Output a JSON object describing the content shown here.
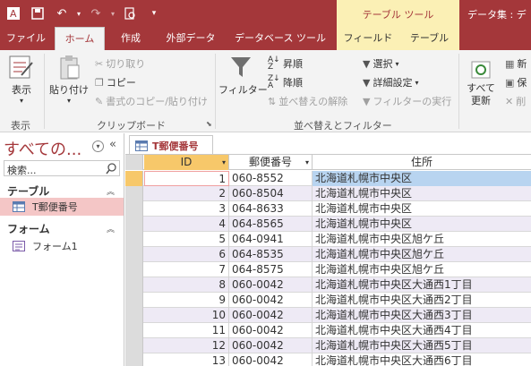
{
  "colors": {
    "accent": "#a4373a",
    "context": "#fbf0b5",
    "selected_row": "#f7c86a",
    "alt_row": "#eeeaf5",
    "nav_selected": "#f4c6c6"
  },
  "window": {
    "title": "データ集 : デ",
    "context_group": "テーブル ツール"
  },
  "qat": {
    "icons": [
      "save-icon",
      "undo-icon",
      "redo-icon",
      "print-preview-icon",
      "customize-icon"
    ]
  },
  "tabs": [
    {
      "label": "ファイル"
    },
    {
      "label": "ホーム"
    },
    {
      "label": "作成"
    },
    {
      "label": "外部データ"
    },
    {
      "label": "データベース ツール"
    },
    {
      "label": "フィールド"
    },
    {
      "label": "テーブル"
    }
  ],
  "ribbon": {
    "view": {
      "label": "表示",
      "group": "表示"
    },
    "clipboard": {
      "paste": "貼り付け",
      "cut": "切り取り",
      "copy": "コピー",
      "format_painter": "書式のコピー/貼り付け",
      "group": "クリップボード"
    },
    "sort": {
      "filter": "フィルター",
      "asc": "昇順",
      "desc": "降順",
      "clear": "並べ替えの解除",
      "select": "選択",
      "advanced": "詳細設定",
      "toggle": "フィルターの実行",
      "group": "並べ替えとフィルター"
    },
    "records": {
      "refresh": "すべて 更新",
      "new": "新",
      "save": "保",
      "delete": "削"
    }
  },
  "nav": {
    "title": "すべての...",
    "search_placeholder": "検索...",
    "sections": [
      {
        "label": "テーブル",
        "items": [
          {
            "label": "T郵便番号"
          }
        ]
      },
      {
        "label": "フォーム",
        "items": [
          {
            "label": "フォーム1"
          }
        ]
      }
    ]
  },
  "doc": {
    "tab": "T郵便番号"
  },
  "table": {
    "columns": [
      "ID",
      "郵便番号",
      "住所"
    ],
    "rows": [
      {
        "id": "1",
        "zip": "060-8552",
        "addr": "北海道札幌市中央区"
      },
      {
        "id": "2",
        "zip": "060-8504",
        "addr": "北海道札幌市中央区"
      },
      {
        "id": "3",
        "zip": "064-8633",
        "addr": "北海道札幌市中央区"
      },
      {
        "id": "4",
        "zip": "064-8565",
        "addr": "北海道札幌市中央区"
      },
      {
        "id": "5",
        "zip": "064-0941",
        "addr": "北海道札幌市中央区旭ケ丘"
      },
      {
        "id": "6",
        "zip": "064-8535",
        "addr": "北海道札幌市中央区旭ケ丘"
      },
      {
        "id": "7",
        "zip": "064-8575",
        "addr": "北海道札幌市中央区旭ケ丘"
      },
      {
        "id": "8",
        "zip": "060-0042",
        "addr": "北海道札幌市中央区大通西1丁目"
      },
      {
        "id": "9",
        "zip": "060-0042",
        "addr": "北海道札幌市中央区大通西2丁目"
      },
      {
        "id": "10",
        "zip": "060-0042",
        "addr": "北海道札幌市中央区大通西3丁目"
      },
      {
        "id": "11",
        "zip": "060-0042",
        "addr": "北海道札幌市中央区大通西4丁目"
      },
      {
        "id": "12",
        "zip": "060-0042",
        "addr": "北海道札幌市中央区大通西5丁目"
      },
      {
        "id": "13",
        "zip": "060-0042",
        "addr": "北海道札幌市中央区大通西6丁目"
      }
    ]
  }
}
